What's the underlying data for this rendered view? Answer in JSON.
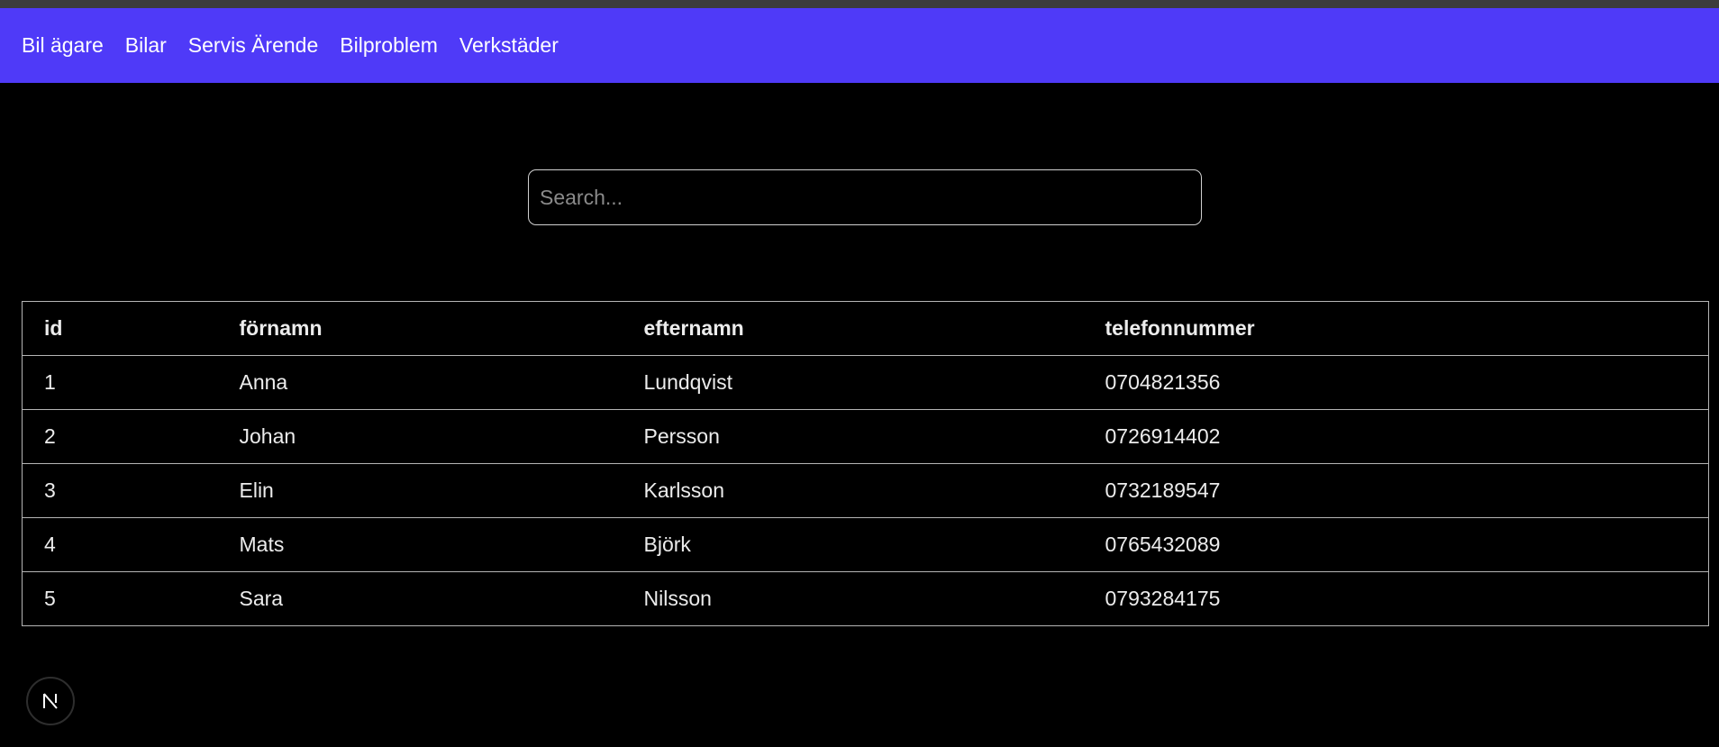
{
  "nav": {
    "items": [
      {
        "label": "Bil ägare"
      },
      {
        "label": "Bilar"
      },
      {
        "label": "Servis Ärende"
      },
      {
        "label": "Bilproblem"
      },
      {
        "label": "Verkstäder"
      }
    ]
  },
  "search": {
    "placeholder": "Search...",
    "value": ""
  },
  "table": {
    "headers": [
      "id",
      "förnamn",
      "efternamn",
      "telefonnummer"
    ],
    "rows": [
      [
        "1",
        "Anna",
        "Lundqvist",
        "0704821356"
      ],
      [
        "2",
        "Johan",
        "Persson",
        "0726914402"
      ],
      [
        "3",
        "Elin",
        "Karlsson",
        "0732189547"
      ],
      [
        "4",
        "Mats",
        "Björk",
        "0765432089"
      ],
      [
        "5",
        "Sara",
        "Nilsson",
        "0793284175"
      ]
    ]
  },
  "badge": {
    "icon": "nextjs-logo-icon"
  },
  "colors": {
    "navbar": "#4f3af8",
    "background": "#000000",
    "text": "#ececec",
    "border": "#b5b5b5"
  }
}
